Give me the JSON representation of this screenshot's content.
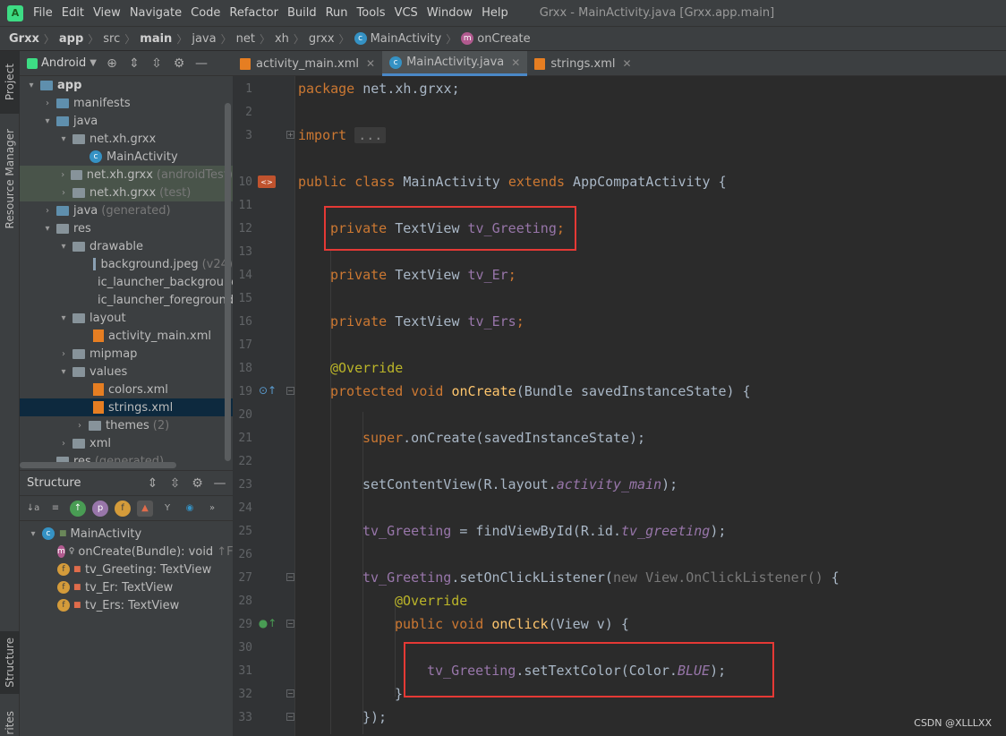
{
  "menubar": {
    "items": [
      "File",
      "Edit",
      "View",
      "Navigate",
      "Code",
      "Refactor",
      "Build",
      "Run",
      "Tools",
      "VCS",
      "Window",
      "Help"
    ],
    "window_title": "Grxx - MainActivity.java [Grxx.app.main]"
  },
  "breadcrumb": [
    "Grxx",
    "app",
    "src",
    "main",
    "java",
    "net",
    "xh",
    "grxx",
    "MainActivity",
    "onCreate"
  ],
  "left_strip": {
    "project": "Project",
    "resource_manager": "Resource Manager",
    "structure": "Structure",
    "favorites": "rites"
  },
  "project_panel": {
    "view_mode": "Android",
    "tree": [
      {
        "label": "app",
        "note": ""
      },
      {
        "label": "manifests",
        "note": ""
      },
      {
        "label": "java",
        "note": ""
      },
      {
        "label": "net.xh.grxx",
        "note": ""
      },
      {
        "label": "MainActivity",
        "note": ""
      },
      {
        "label": "net.xh.grxx",
        "note": "(androidTest)"
      },
      {
        "label": "net.xh.grxx",
        "note": "(test)"
      },
      {
        "label": "java",
        "note": "(generated)"
      },
      {
        "label": "res",
        "note": ""
      },
      {
        "label": "drawable",
        "note": ""
      },
      {
        "label": "background.jpeg",
        "note": "(v24)"
      },
      {
        "label": "ic_launcher_background.",
        "note": ""
      },
      {
        "label": "ic_launcher_foreground.x",
        "note": ""
      },
      {
        "label": "layout",
        "note": ""
      },
      {
        "label": "activity_main.xml",
        "note": ""
      },
      {
        "label": "mipmap",
        "note": ""
      },
      {
        "label": "values",
        "note": ""
      },
      {
        "label": "colors.xml",
        "note": ""
      },
      {
        "label": "strings.xml",
        "note": ""
      },
      {
        "label": "themes",
        "note": "(2)"
      },
      {
        "label": "xml",
        "note": ""
      },
      {
        "label": "res",
        "note": "(generated)"
      }
    ]
  },
  "structure_panel": {
    "title": "Structure",
    "items": [
      {
        "label": "MainActivity"
      },
      {
        "label": "onCreate(Bundle): void",
        "note": "↑Fra"
      },
      {
        "label": "tv_Greeting: TextView"
      },
      {
        "label": "tv_Er: TextView"
      },
      {
        "label": "tv_Ers: TextView"
      }
    ]
  },
  "tabs": [
    {
      "label": "activity_main.xml"
    },
    {
      "label": "MainActivity.java"
    },
    {
      "label": "strings.xml"
    }
  ],
  "editor": {
    "line_numbers": [
      "1",
      "2",
      "3",
      "10",
      "11",
      "12",
      "13",
      "14",
      "15",
      "16",
      "17",
      "18",
      "19",
      "20",
      "21",
      "22",
      "23",
      "24",
      "25",
      "26",
      "27",
      "28",
      "29",
      "30",
      "31",
      "32",
      "33"
    ],
    "code": {
      "l1": {
        "kw": "package",
        "rest": " net.xh.grxx;"
      },
      "l3": {
        "kw": "import",
        "fold": "..."
      },
      "l10": {
        "kw1": "public class",
        "name": " MainActivity ",
        "kw2": "extends",
        "rest": " AppCompatActivity {"
      },
      "l12": {
        "kw": "private",
        "type": " TextView ",
        "field": "tv_Greeting",
        "end": ";"
      },
      "l14": {
        "kw": "private",
        "type": " TextView ",
        "field": "tv_Er",
        "end": ";"
      },
      "l16": {
        "kw": "private",
        "type": " TextView ",
        "field": "tv_Ers",
        "end": ";"
      },
      "l18": {
        "anno": "@Override"
      },
      "l19": {
        "kw": "protected void",
        "fn": " onCreate",
        "rest": "(Bundle savedInstanceState) {"
      },
      "l21": {
        "kw": "super",
        "rest": ".onCreate(savedInstanceState);"
      },
      "l23": {
        "pre": "setContentView(R.layout.",
        "ital": "activity_main",
        "post": ");"
      },
      "l25": {
        "field": "tv_Greeting",
        "pre": " = findViewById(R.id.",
        "ital": "tv_greeting",
        "post": ");"
      },
      "l27": {
        "field": "tv_Greeting",
        "pre": ".setOnClickListener(",
        "dim": "new View.OnClickListener()",
        "post": " {"
      },
      "l28": {
        "anno": "@Override"
      },
      "l29": {
        "kw": "public void",
        "fn": " onClick",
        "rest": "(View v) {"
      },
      "l31": {
        "field": "tv_Greeting",
        "pre": ".setTextColor(Color.",
        "ital": "BLUE",
        "post": ");"
      },
      "l32": {
        "rest": "}"
      },
      "l33": {
        "rest": "});"
      }
    }
  },
  "watermark": "CSDN @XLLLXX"
}
